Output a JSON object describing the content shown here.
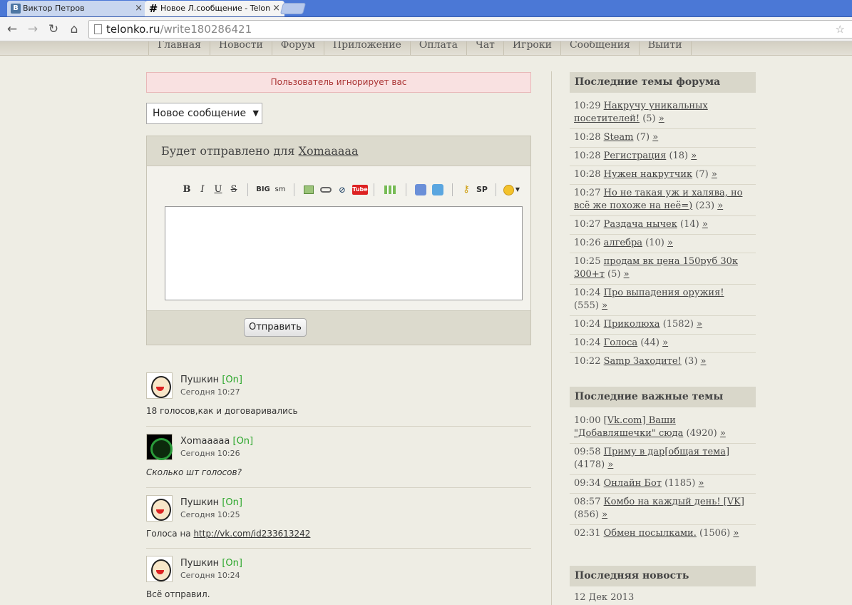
{
  "browser": {
    "tabs": [
      {
        "title": "Виктор Петров",
        "favicon": "vk-icon",
        "state": "inactive"
      },
      {
        "title": "Новое Л.сообщение - Telon",
        "favicon": "hash-icon",
        "state": "active"
      }
    ],
    "url_host": "telonko.ru",
    "url_path": "/write180286421",
    "tab_close": "×"
  },
  "site_nav": [
    "Главная",
    "Новости",
    "Форум",
    "Приложение",
    "Оплата",
    "Чат",
    "Игроки",
    "Сообщения",
    "Выйти"
  ],
  "alert": "Пользователь игнорирует вас",
  "message_type": "Новое сообщение",
  "compose": {
    "heading_prefix": "Будет отправлено для",
    "recipient": "Xomaaaaa",
    "submit_label": "Отправить",
    "editor_textarea": ""
  },
  "messages": [
    {
      "author": "Пушкин",
      "status": "[On]",
      "time": "Сегодня 10:27",
      "text": "18 голосов,как и договаривались",
      "avatar": "cartoon-avatar",
      "italic": false
    },
    {
      "author": "Xomaaaaa",
      "status": "[On]",
      "time": "Сегодня 10:26",
      "text": "Сколько шт голосов?",
      "avatar": "dark-green-avatar",
      "italic": true
    },
    {
      "author": "Пушкин",
      "status": "[On]",
      "time": "Сегодня 10:25",
      "text_prefix": "Голоса на ",
      "link": "http://vk.com/id233613242",
      "avatar": "cartoon-avatar",
      "italic": false
    },
    {
      "author": "Пушкин",
      "status": "[On]",
      "time": "Сегодня 10:24",
      "text": "Всё отправил.",
      "avatar": "cartoon-avatar",
      "italic": false
    }
  ],
  "sidebar": {
    "forum_title": "Последние темы форума",
    "forum_topics": [
      {
        "time": "10:29",
        "title": "Накручу уникальных посетителей!",
        "count": "(5)"
      },
      {
        "time": "10:28",
        "title": "Steam",
        "count": "(7)"
      },
      {
        "time": "10:28",
        "title": "Регистрация",
        "count": "(18)"
      },
      {
        "time": "10:28",
        "title": "Нужен накрутчик",
        "count": "(7)"
      },
      {
        "time": "10:27",
        "title": "Но не такая уж и халява, но всё же похоже на неё=)",
        "count": "(23)"
      },
      {
        "time": "10:27",
        "title": "Раздача нычек",
        "count": "(14)"
      },
      {
        "time": "10:26",
        "title": "алгебра",
        "count": "(10)"
      },
      {
        "time": "10:25",
        "title": "продам вк цена 150руб 30к 300+т",
        "count": "(5)"
      },
      {
        "time": "10:24",
        "title": "Про выпадения оружия!",
        "count": "(555)"
      },
      {
        "time": "10:24",
        "title": "Приколюха",
        "count": "(1582)"
      },
      {
        "time": "10:24",
        "title": "Голоса",
        "count": "(44)"
      },
      {
        "time": "10:22",
        "title": "Samp Заходите!",
        "count": "(3)"
      }
    ],
    "important_title": "Последние важные темы",
    "important_topics": [
      {
        "time": "10:00",
        "title": "[Vk.com] Ваши \"Добавляшечки\" сюда",
        "count": "(4920)"
      },
      {
        "time": "09:58",
        "title": "Приму в дар[общая тема]",
        "count": "(4178)"
      },
      {
        "time": "09:34",
        "title": "Онлайн Бот",
        "count": "(1185)"
      },
      {
        "time": "08:57",
        "title": "Комбо на каждый день! [VK]",
        "count": "(856)"
      },
      {
        "time": "02:31",
        "title": "Обмен посылками.",
        "count": "(1506)"
      }
    ],
    "news_title": "Последняя новость",
    "news_date": "12 Дек 2013",
    "raquo": "»"
  },
  "colors": {
    "online": "#2aa62a",
    "alert_bg": "#f9e1e1",
    "alert_text": "#aa3333",
    "page_bg": "#eeede4"
  }
}
